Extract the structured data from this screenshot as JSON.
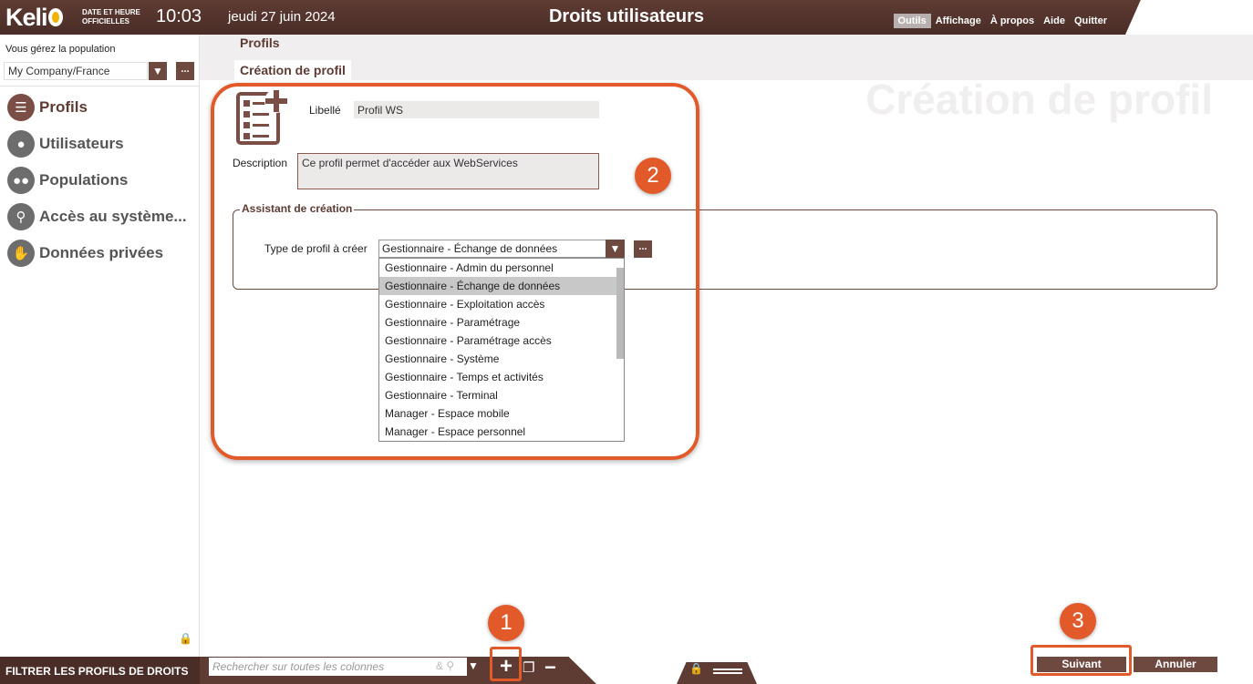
{
  "header": {
    "logo": "Keli",
    "official_time_label_line1": "DATE ET HEURE",
    "official_time_label_line2": "OFFICIELLES",
    "time": "10:03",
    "date": "jeudi 27 juin 2024",
    "title": "Droits utilisateurs",
    "menu": [
      "Outils",
      "Affichage",
      "À propos",
      "Aide",
      "Quitter"
    ],
    "active_menu": "Outils"
  },
  "sidebar": {
    "population_label": "Vous gérez la population",
    "population_value": "My Company/France",
    "more_label": "...",
    "items": [
      {
        "label": "Profils",
        "icon": "profiles-icon"
      },
      {
        "label": "Utilisateurs",
        "icon": "user-icon"
      },
      {
        "label": "Populations",
        "icon": "group-icon"
      },
      {
        "label": "Accès au système...",
        "icon": "key-icon"
      },
      {
        "label": "Données privées",
        "icon": "hand-stop-icon"
      }
    ]
  },
  "breadcrumb": {
    "level1": "Profils",
    "level2": "Création de profil",
    "watermark": "Création de profil"
  },
  "form": {
    "libelle_label": "Libellé",
    "libelle_value": "Profil WS",
    "description_label": "Description",
    "description_value": "Ce profil permet d'accéder aux WebServices",
    "wizard_legend": "Assistant de création",
    "type_label": "Type de profil à créer",
    "type_value": "Gestionnaire - Échange de données",
    "more_label": "...",
    "options": [
      "Gestionnaire - Admin du personnel",
      "Gestionnaire - Échange de données",
      "Gestionnaire - Exploitation accès",
      "Gestionnaire - Paramétrage",
      "Gestionnaire - Paramétrage accès",
      "Gestionnaire - Système",
      "Gestionnaire - Temps et activités",
      "Gestionnaire - Terminal",
      "Manager - Espace mobile",
      "Manager - Espace personnel"
    ],
    "selected_option_index": 1
  },
  "callouts": {
    "one": "1",
    "two": "2",
    "three": "3"
  },
  "bottombar": {
    "filter_label": "FILTRER LES PROFILS DE DROITS",
    "search_placeholder": "Rechercher sur toutes les colonnes",
    "next_label": "Suivant",
    "cancel_label": "Annuler"
  },
  "colors": {
    "brand": "#5e3b33",
    "accent": "#e25a2a",
    "logo_dot": "#f0b400"
  }
}
